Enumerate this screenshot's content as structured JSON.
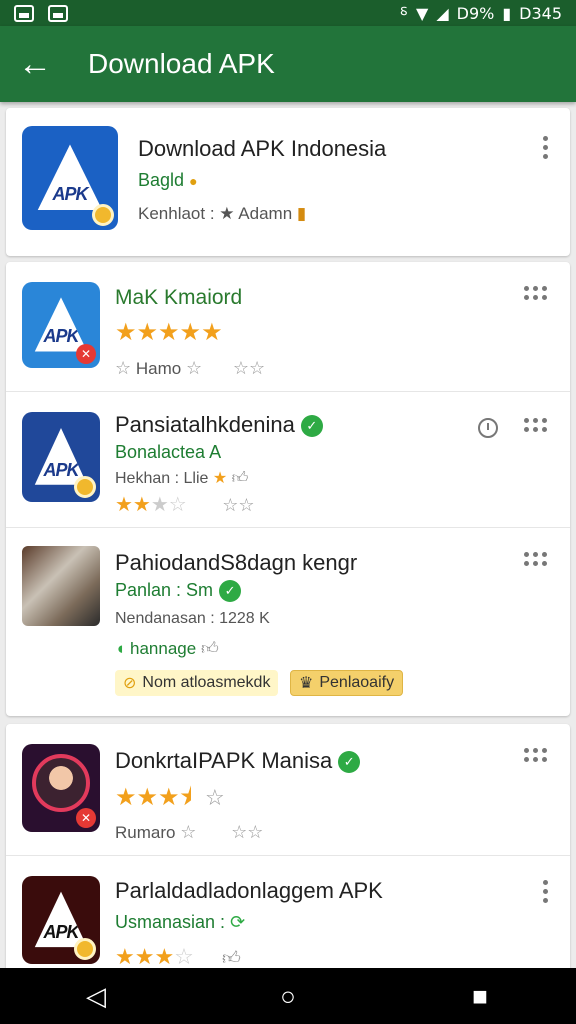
{
  "status_bar": {
    "battery_text": "D9%",
    "time": "D345"
  },
  "app_bar": {
    "title": "Download APK"
  },
  "featured": {
    "title": "Download APK Indonesia",
    "subtitle": "Bagld",
    "meta": "Kenhlaot : ★ Adamn",
    "icon_text": "APK"
  },
  "items": [
    {
      "title": "MaK Kmaiord",
      "stars": 5,
      "meta1": "Hamo",
      "icon_text": "APK"
    },
    {
      "title": "Pansiatalhkdenina",
      "subtitle": "Bonalactea A",
      "meta1": "Hekhan : Llie",
      "stars": 2,
      "icon_text": "APK"
    },
    {
      "title": "PahiodandS8dagn kengr",
      "subtitle": "Panlan : Sm",
      "meta1": "Nendanasan : 1228 K",
      "meta2": "hannage",
      "chip1": "Nom atloasmekdk",
      "chip2": "Penlaoaify"
    },
    {
      "title": "DonkrtaIPAPK Manisa",
      "stars": 3.5,
      "meta1": "Rumaro"
    },
    {
      "title": "Parlaldadladonlaggem APK",
      "subtitle": "Usmanasian :",
      "stars": 3,
      "icon_text": "APK"
    }
  ],
  "colors": {
    "primary": "#22743a",
    "status": "#1b5e2c",
    "green_text": "#1e7d32",
    "star": "#f2a01c"
  },
  "nav": {
    "back": "◁",
    "home": "○",
    "recents": "■"
  }
}
